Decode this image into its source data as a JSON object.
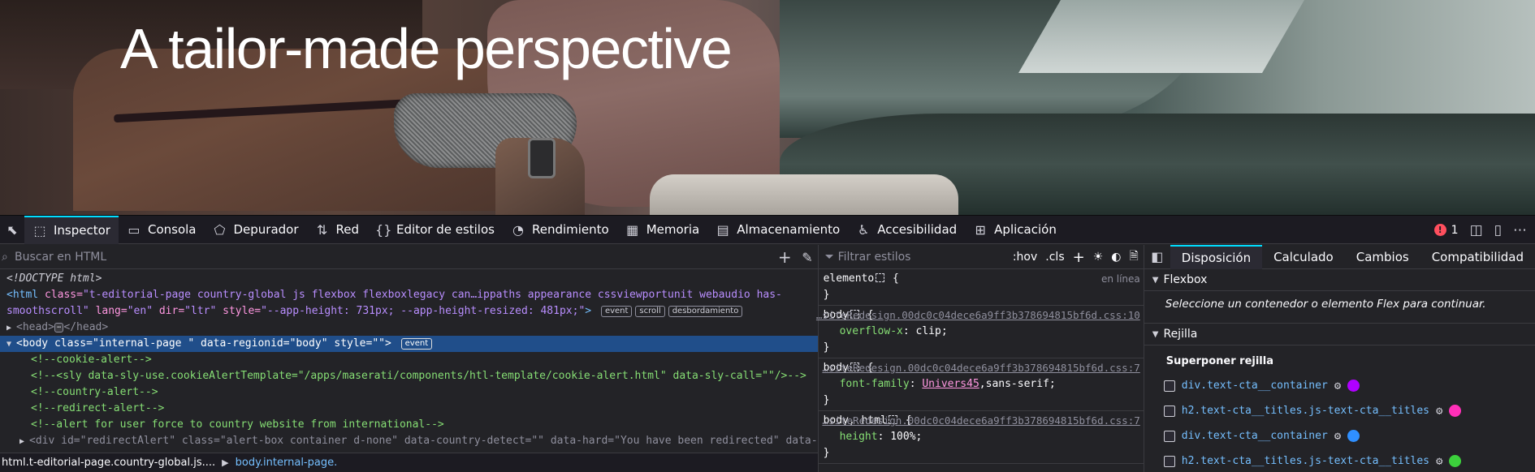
{
  "hero": {
    "title": "A tailor-made perspective"
  },
  "devtools": {
    "tabs": [
      {
        "label": "Inspector",
        "icon": "inspector-icon",
        "glyph": "⬚"
      },
      {
        "label": "Consola",
        "icon": "console-icon",
        "glyph": "▭"
      },
      {
        "label": "Depurador",
        "icon": "debugger-icon",
        "glyph": "⬠"
      },
      {
        "label": "Red",
        "icon": "network-icon",
        "glyph": "⇅"
      },
      {
        "label": "Editor de estilos",
        "icon": "style-editor-icon",
        "glyph": "{}"
      },
      {
        "label": "Rendimiento",
        "icon": "performance-icon",
        "glyph": "◔"
      },
      {
        "label": "Memoria",
        "icon": "memory-icon",
        "glyph": "▦"
      },
      {
        "label": "Almacenamiento",
        "icon": "storage-icon",
        "glyph": "▤"
      },
      {
        "label": "Accesibilidad",
        "icon": "accessibility-icon",
        "glyph": "♿"
      },
      {
        "label": "Aplicación",
        "icon": "application-icon",
        "glyph": "⊞"
      }
    ],
    "error_count": "1",
    "html_search_placeholder": "Buscar en HTML",
    "styles_filter_placeholder": "Filtrar estilos",
    "hov_label": ":hov",
    "cls_label": ".cls",
    "markup": {
      "doctype": "<!DOCTYPE html>",
      "html_line": {
        "tag_open": "<html",
        "class_attr": "class=",
        "class_val": "\"t-editorial-page country-global js flexbox flexboxlegacy can…ippaths appearance cssviewportunit webaudio has-",
        "cont": "smoothscroll\"",
        "lang_attr": "lang=",
        "lang_val": "\"en\"",
        "dir_attr": "dir=",
        "dir_val": "\"ltr\"",
        "style_attr": "style=",
        "style_val": "\"--app-height: 731px; --app-height-resized: 481px;\"",
        "close": ">",
        "badges": [
          "event",
          "scroll",
          "desbordamiento"
        ]
      },
      "head_line": {
        "open": "<head>",
        "close": "</head>"
      },
      "body_line": {
        "tag_open": "<body",
        "class_attr": "class=",
        "class_val": "\"internal-page \"",
        "region_attr": "data-regionid=",
        "region_val": "\"body\"",
        "style_attr": "style=",
        "style_val": "\"\"",
        "close": ">",
        "badge": "event"
      },
      "comments": [
        "<!--cookie-alert-->",
        "<!--<sly data-sly-use.cookieAlertTemplate=\"/apps/maserati/components/htl-template/cookie-alert.html\" data-sly-call=\"\"/>-->",
        "<!--country-alert-->",
        "<!--redirect-alert-->",
        "<!--alert for user force to country website from international-->"
      ],
      "div_line": {
        "tag_open": "<div",
        "id_attr": "id=",
        "id_val": "\"redirectAlert\"",
        "class_attr": "class=",
        "class_val": "\"alert-box container d-none\"",
        "detect_attr": "data-country-detect=",
        "detect_val": "\"\"",
        "hard_attr": "data-hard=",
        "hard_val": "\"You have been redirected\"",
        "tail": "data-"
      }
    },
    "breadcrumb": {
      "item1": "html.t-editorial-page.country-global.js....",
      "item2": "body.internal-page."
    },
    "rules": [
      {
        "selector": "elemento",
        "source": "en línea",
        "source_plain": true,
        "props": []
      },
      {
        "selector": "body",
        "source": "…siteRedesign.00dc0c04dece6a9ff3b378694815bf6d.css:10",
        "props": [
          {
            "name": "overflow-x",
            "value": "clip",
            "link": false
          }
        ]
      },
      {
        "selector": "body",
        "source": "…siteRedesign.00dc0c04dece6a9ff3b378694815bf6d.css:7",
        "props": [
          {
            "name": "font-family",
            "value": "Univers45",
            "link": true,
            "extra": ",sans-serif"
          }
        ]
      },
      {
        "selector": "body, html",
        "source": "…siteRedesign.00dc0c04dece6a9ff3b378694815bf6d.css:7",
        "props": [
          {
            "name": "height",
            "value": "100%",
            "link": false
          }
        ]
      }
    ],
    "layout": {
      "tabs": [
        "Disposición",
        "Calculado",
        "Cambios",
        "Compatibilidad"
      ],
      "flexbox_header": "Flexbox",
      "flexbox_msg": "Seleccione un contenedor o elemento Flex para continuar.",
      "grid_header": "Rejilla",
      "overlay_header": "Superponer rejilla",
      "grids": [
        {
          "name": "div.text-cta__container",
          "color": "#b000ff"
        },
        {
          "name": "h2.text-cta__titles.js-text-cta__titles",
          "color": "#ff2fb8"
        },
        {
          "name": "div.text-cta__container",
          "color": "#2f8fff"
        },
        {
          "name": "h2.text-cta__titles.js-text-cta__titles",
          "color": "#3cd03c"
        }
      ]
    }
  }
}
